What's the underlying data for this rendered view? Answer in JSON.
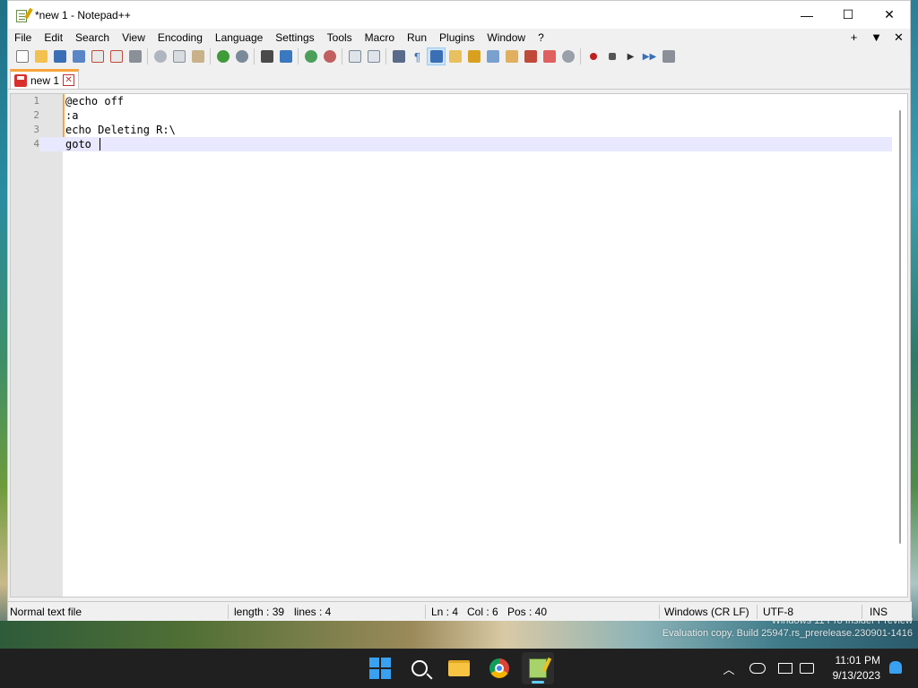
{
  "window": {
    "title": "*new 1 - Notepad++",
    "minimize": "—",
    "maximize": "☐",
    "close": "✕"
  },
  "menu": {
    "items": [
      "File",
      "Edit",
      "Search",
      "View",
      "Encoding",
      "Language",
      "Settings",
      "Tools",
      "Macro",
      "Run",
      "Plugins",
      "Window",
      "?"
    ],
    "right": [
      "+",
      "▼",
      "✕"
    ]
  },
  "tab": {
    "label": "new 1"
  },
  "editor": {
    "lines": [
      {
        "num": "1",
        "text": "@echo off"
      },
      {
        "num": "2",
        "text": ":a"
      },
      {
        "num": "3",
        "text": "echo Deleting R:\\"
      },
      {
        "num": "4",
        "text": "goto "
      }
    ],
    "current_line": 4
  },
  "status": {
    "file_type": "Normal text file",
    "length": "length : 39",
    "lines": "lines : 4",
    "ln": "Ln : 4",
    "col": "Col : 6",
    "pos": "Pos : 40",
    "eol": "Windows (CR LF)",
    "encoding": "UTF-8",
    "mode": "INS"
  },
  "desktop": {
    "watermark_line1": "Windows 11 Pro Insider Preview",
    "watermark_line2": "Evaluation copy. Build 25947.rs_prerelease.230901-1416"
  },
  "taskbar": {
    "time": "11:01 PM",
    "date": "9/13/2023"
  },
  "colors": {
    "accent_orange": "#f7a33b",
    "current_line_bg": "#e8e8ff",
    "taskbar_bg": "#202020"
  }
}
